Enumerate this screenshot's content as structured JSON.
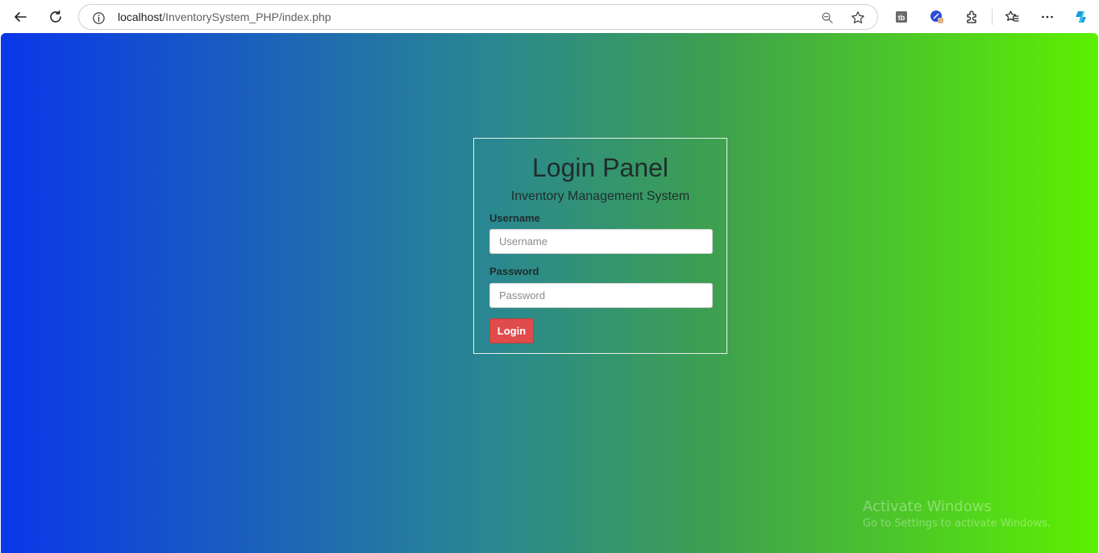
{
  "browser": {
    "url_host": "localhost",
    "url_path": "/InventorySystem_PHP/index.php",
    "icons": [
      "back-icon",
      "reload-icon",
      "info-icon",
      "zoom-icon",
      "star-icon",
      "extension-tb-icon",
      "profile-icon",
      "puzzle-icon",
      "favorites-icon",
      "more-icon",
      "copilot-icon"
    ]
  },
  "login": {
    "title": "Login Panel",
    "subtitle": "Inventory Management System",
    "username_label": "Username",
    "username_placeholder": "Username",
    "username_value": "",
    "password_label": "Password",
    "password_placeholder": "Password",
    "password_value": "",
    "button_label": "Login"
  },
  "watermark": {
    "line1": "Activate Windows",
    "line2": "Go to Settings to activate Windows."
  },
  "colors": {
    "gradient_start": "#0a37ea",
    "gradient_end": "#5cf000",
    "login_button": "#e04b4b"
  }
}
